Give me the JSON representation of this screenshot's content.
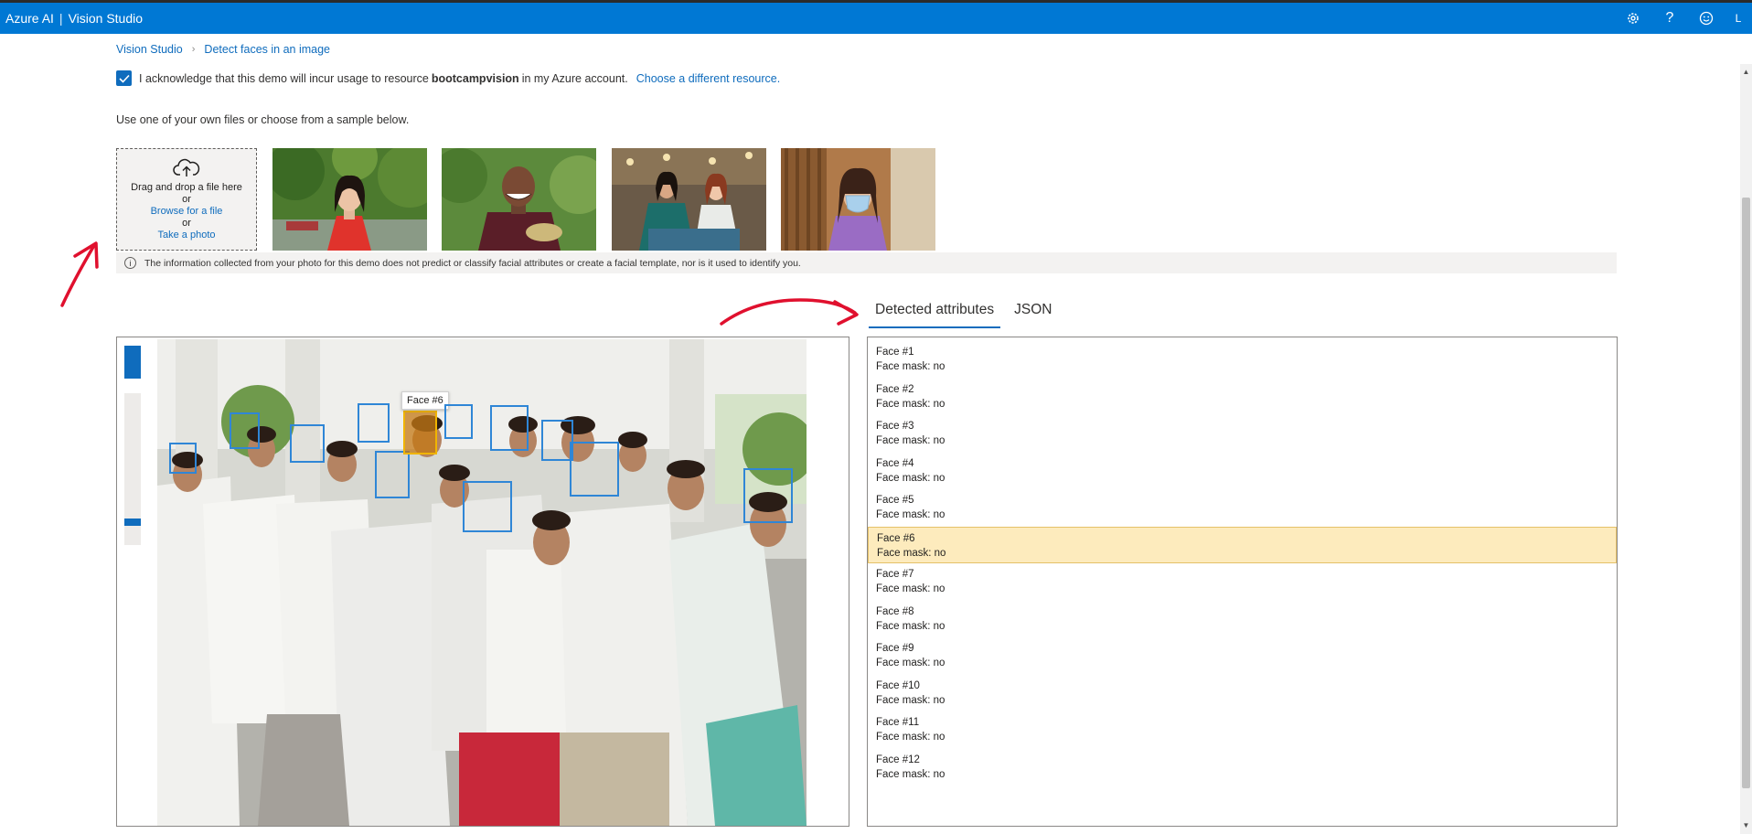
{
  "topbar": {
    "brand_left": "Azure AI",
    "brand_sep": "|",
    "brand_right": "Vision Studio",
    "user_initial": "L",
    "help": "?"
  },
  "breadcrumb": {
    "home": "Vision Studio",
    "current": "Detect faces in an image"
  },
  "ack": {
    "text_before": "I acknowledge that this demo will incur usage to resource",
    "resource": "bootcampvision",
    "text_after": "in my Azure account.",
    "link": "Choose a different resource."
  },
  "intro": "Use one of your own files or choose from a sample below.",
  "upload": {
    "line1": "Drag and drop a file here",
    "or1": "or",
    "browse": "Browse for a file",
    "or2": "or",
    "photo": "Take a photo"
  },
  "info_notice": "The information collected from your photo for this demo does not predict or classify facial attributes or create a facial template, nor is it used to identify you.",
  "tabs": [
    "Detected attributes",
    "JSON"
  ],
  "tooltip": "Face #6",
  "faces": [
    {
      "label": "Face #1",
      "mask": "Face mask: no"
    },
    {
      "label": "Face #2",
      "mask": "Face mask: no"
    },
    {
      "label": "Face #3",
      "mask": "Face mask: no"
    },
    {
      "label": "Face #4",
      "mask": "Face mask: no"
    },
    {
      "label": "Face #5",
      "mask": "Face mask: no"
    },
    {
      "label": "Face #6",
      "mask": "Face mask: no"
    },
    {
      "label": "Face #7",
      "mask": "Face mask: no"
    },
    {
      "label": "Face #8",
      "mask": "Face mask: no"
    },
    {
      "label": "Face #9",
      "mask": "Face mask: no"
    },
    {
      "label": "Face #10",
      "mask": "Face mask: no"
    },
    {
      "label": "Face #11",
      "mask": "Face mask: no"
    },
    {
      "label": "Face #12",
      "mask": "Face mask: no"
    }
  ],
  "colors": {
    "accent": "#0078d4",
    "link": "#0f6cbd",
    "box": "#2f86d6",
    "selected_box": "#f0b400",
    "selected_row": "#fdebbd",
    "annotation": "#e0102e"
  }
}
